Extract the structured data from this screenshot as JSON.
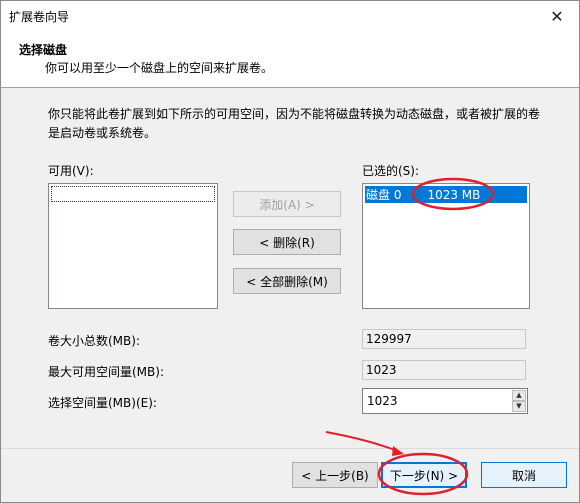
{
  "window": {
    "title": "扩展卷向导",
    "close_glyph": "✕"
  },
  "header": {
    "title": "选择磁盘",
    "subtitle": "你可以用至少一个磁盘上的空间来扩展卷。"
  },
  "description": "你只能将此卷扩展到如下所示的可用空间，因为不能将磁盘转换为动态磁盘，或者被扩展的卷是启动卷或系统卷。",
  "available": {
    "label": "可用(V):"
  },
  "selected": {
    "label": "已选的(S):",
    "items": [
      {
        "disk": "磁盘 0",
        "size": "1023 MB"
      }
    ]
  },
  "buttons": {
    "add": "添加(A) >",
    "remove": "< 删除(R)",
    "remove_all": "< 全部删除(M)"
  },
  "fields": {
    "total_label": "卷大小总数(MB):",
    "total_value": "129997",
    "max_label": "最大可用空间量(MB):",
    "max_value": "1023",
    "select_label": "选择空间量(MB)(E):",
    "select_value": "1023"
  },
  "footer": {
    "back": "< 上一步(B)",
    "next": "下一步(N) >",
    "cancel": "取消"
  },
  "annotation_color": "#e0202a"
}
